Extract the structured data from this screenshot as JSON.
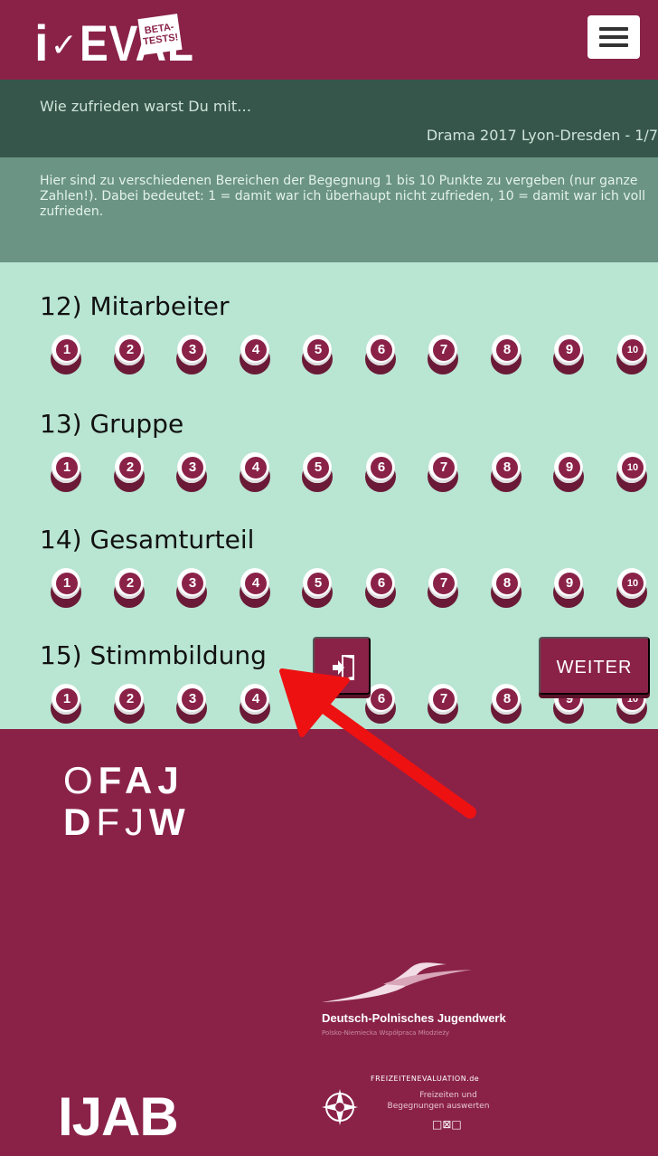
{
  "app": {
    "logo_i": "i",
    "logo_check": "✓",
    "logo_eval": "EVAL",
    "beta_label": "BETA-TESTS!"
  },
  "subheader": {
    "question": "Wie zufrieden warst Du mit…",
    "survey": "Drama 2017 Lyon-Dresden - 1/7"
  },
  "info": {
    "text": "Hier sind zu verschiedenen Bereichen der Begegnung 1 bis 10 Punkte zu vergeben (nur ganze Zahlen!). Dabei bedeutet: 1 = damit war ich überhaupt nicht zufrieden, 10 = damit war ich voll zufrieden."
  },
  "questions": [
    {
      "title": "12) Mitarbeiter"
    },
    {
      "title": "13) Gruppe"
    },
    {
      "title": "14) Gesamturteil"
    },
    {
      "title": "15) Stimmbildung"
    }
  ],
  "scale": [
    "1",
    "2",
    "3",
    "4",
    "5",
    "6",
    "7",
    "8",
    "9",
    "10"
  ],
  "buttons": {
    "weiter": "WEITER",
    "exit_icon": "exit-icon"
  },
  "footer": {
    "ofaj_line1_left": "O",
    "ofaj_line1_bold": "FAJ",
    "ofaj_line2_bold": "D",
    "ofaj_line2_mid": "FJ",
    "ofaj_line2_end": "W",
    "dpj_name": "Deutsch-Polnisches Jugendwerk",
    "dpj_sub": "Polsko-Niemiecka Współpraca Młodzieży",
    "ijab": "IJAB",
    "fz_title": "FREIZEITENEVALUATION.de",
    "fz_sub1": "Freizeiten und",
    "fz_sub2": "Begegnungen auswerten",
    "fz_icons": "□⊠□"
  },
  "colors": {
    "brand": "#8a2248",
    "dark_green": "#36564c",
    "mid_green": "#6b9484",
    "light_green": "#b9e5d3",
    "arrow": "#ee1111"
  }
}
